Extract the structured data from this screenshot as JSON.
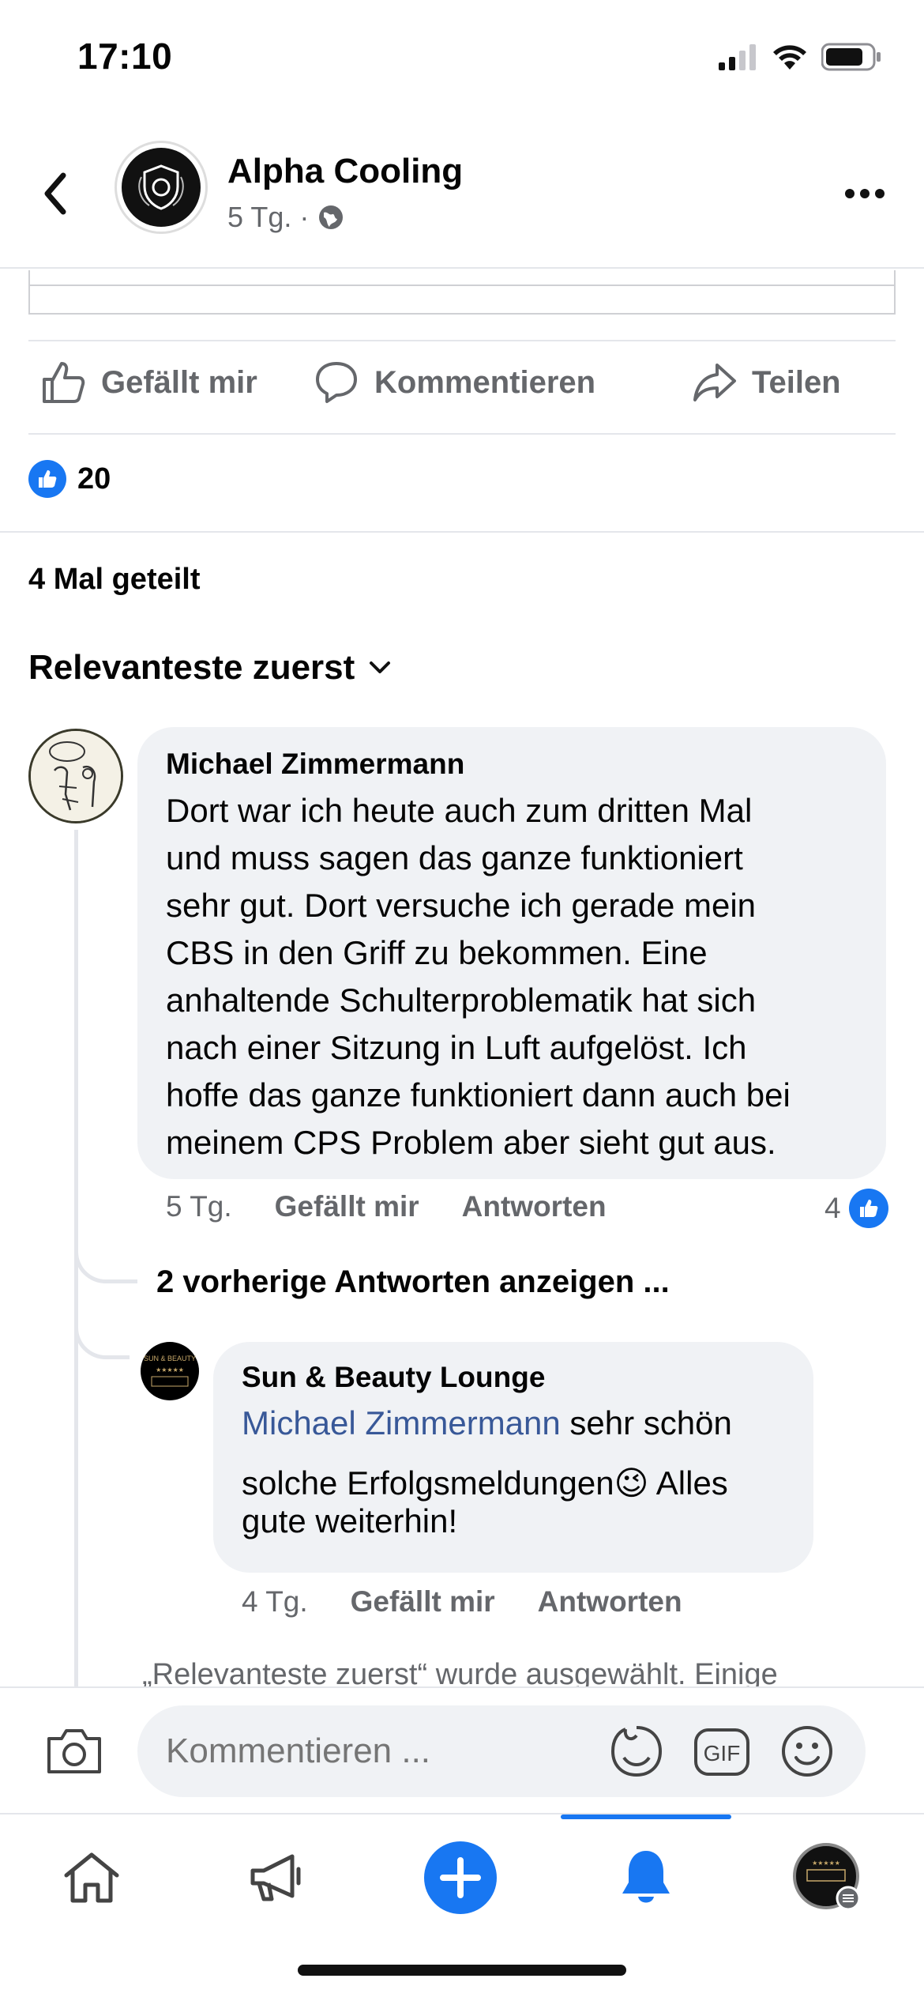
{
  "status_bar": {
    "time": "17:10"
  },
  "header": {
    "page_name": "Alpha Cooling",
    "post_age": "5 Tg.",
    "separator": "·"
  },
  "actions": {
    "like": "Gefällt mir",
    "comment": "Kommentieren",
    "share": "Teilen"
  },
  "reactions": {
    "count": "20"
  },
  "shares": {
    "label": "4 Mal geteilt"
  },
  "sort": {
    "label": "Relevanteste zuerst"
  },
  "comments": [
    {
      "author": "Michael Zimmermann",
      "lines": [
        "Dort war ich heute auch zum dritten Mal",
        "und muss sagen das ganze funktioniert",
        "sehr gut. Dort versuche ich gerade mein",
        "CBS in den Griff zu bekommen. Eine",
        "anhaltende Schulterproblematik hat sich",
        "nach einer Sitzung in Luft aufgelöst. Ich",
        "hoffe das ganze funktioniert dann auch bei",
        "meinem CPS Problem aber sieht gut aus."
      ],
      "age": "5 Tg.",
      "like_label": "Gefällt mir",
      "reply_label": "Antworten",
      "like_count": "4"
    }
  ],
  "more_replies": {
    "label": "2 vorherige Antworten anzeigen ..."
  },
  "reply": {
    "author": "Sun & Beauty Lounge",
    "mention": "Michael Zimmermann",
    "text_1": " sehr schön",
    "text_2": "solche Erfolgsmeldungen",
    "emoji": "😉",
    "text_3": " Alles",
    "text_4": "gute weiterhin!",
    "age": "4 Tg.",
    "like_label": "Gefällt mir",
    "reply_label": "Antworten",
    "avatar_text": "SUN & BEAUTY"
  },
  "info_text": "„Relevanteste zuerst“ wurde ausgewählt. Einige",
  "composer": {
    "placeholder": "Kommentieren ...",
    "gif_label": "GIF"
  },
  "colors": {
    "brand_blue": "#1877f2",
    "bubble": "#f0f2f5",
    "secondary_text": "#65676b"
  },
  "icons": {
    "back": "chevron-left-icon",
    "more": "more-horizontal-icon",
    "globe": "globe-icon",
    "like": "thumbs-up-icon",
    "comment": "comment-icon",
    "share": "share-icon",
    "camera": "camera-icon",
    "sticker": "sticker-icon",
    "gif": "gif-icon",
    "emoji": "emoji-icon",
    "home": "home-icon",
    "megaphone": "megaphone-icon",
    "create": "plus-icon",
    "notifications": "bell-icon"
  }
}
